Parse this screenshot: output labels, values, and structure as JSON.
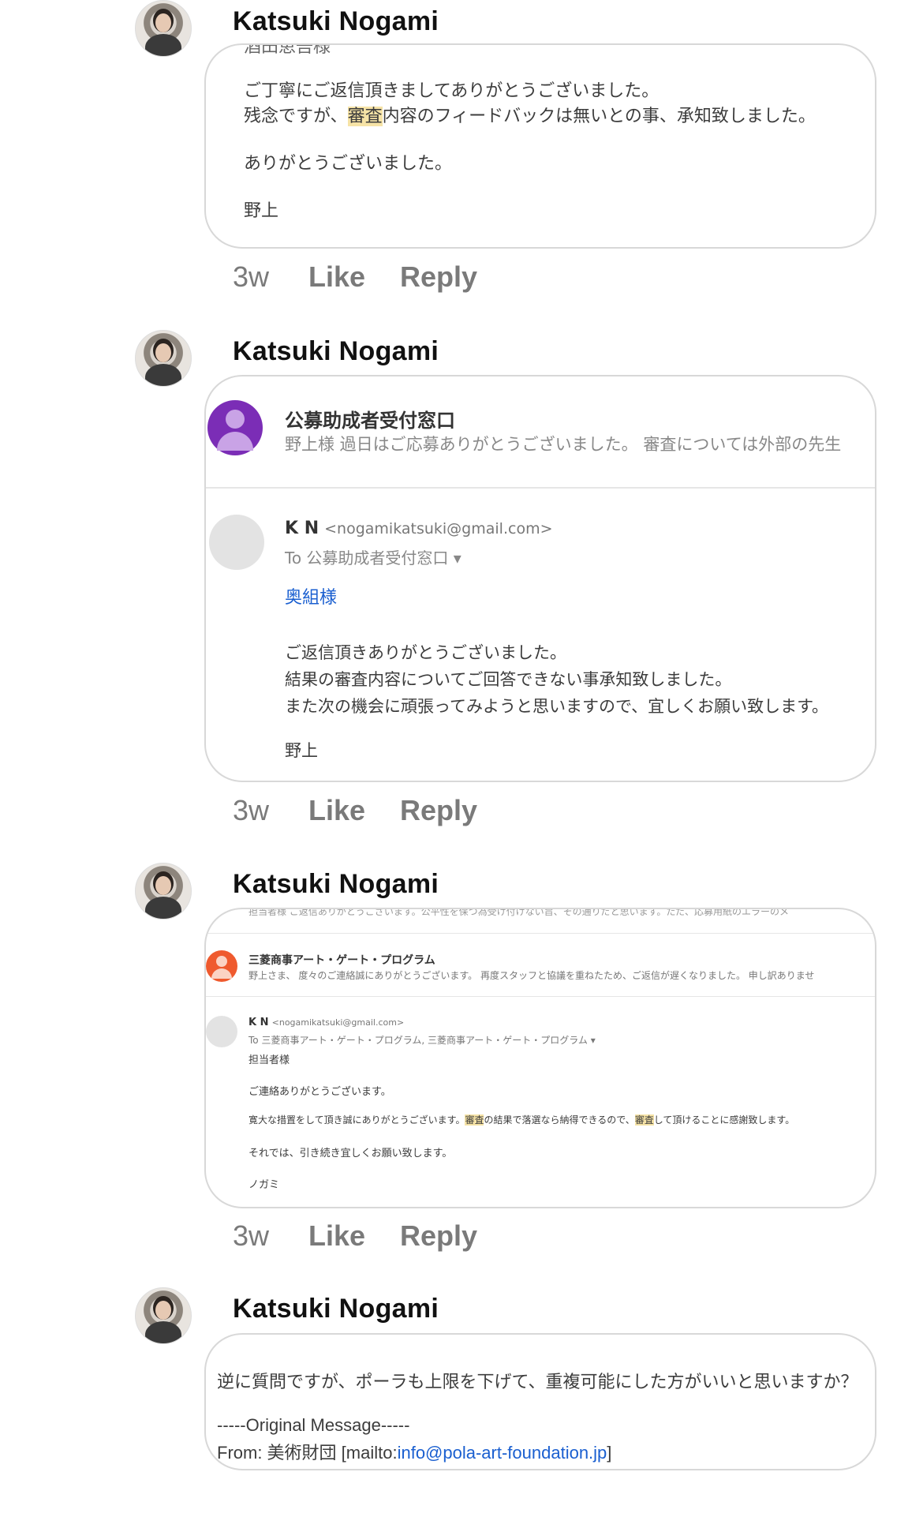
{
  "comments": [
    {
      "author": "Katsuki Nogami",
      "time": "3w",
      "like": "Like",
      "reply": "Reply",
      "email": {
        "top_cut": "酒田恵吾様",
        "lines": [
          "ご丁寧にご返信頂きましてありがとうございました。",
          "残念ですが、",
          "審査",
          "内容のフィードバックは無いとの事、承知致しました。",
          "ありがとうございました。",
          "野上"
        ]
      }
    },
    {
      "author": "Katsuki Nogami",
      "time": "3w",
      "like": "Like",
      "reply": "Reply",
      "email": {
        "sender1_name": "公募助成者受付窓口",
        "sender1_preview": "野上様 過日はご応募ありがとうございました。 審査については外部の先生",
        "sender2_name": "K N",
        "sender2_email": "<nogamikatsuki@gmail.com>",
        "to_line": "To 公募助成者受付窓口 ▾",
        "greeting": "奥組様",
        "lines": [
          "ご返信頂きありがとうございました。",
          "結果の審査内容についてご回答できない事承知致しました。",
          "また次の機会に頑張ってみようと思いますので、宜しくお願い致します。",
          "野上"
        ]
      }
    },
    {
      "author": "Katsuki Nogami",
      "time": "3w",
      "like": "Like",
      "reply": "Reply",
      "email": {
        "top_cut": "担当者様 ご返信ありがとうございます。公平性を保つ為受け付けない旨、その通りだと思います。ただ、応募用紙のエラーのメ",
        "sender1_name": "三菱商事アート・ゲート・プログラム",
        "sender1_preview": "野上さま、 度々のご連絡誠にありがとうございます。 再度スタッフと協議を重ねたため、ご返信が遅くなりました。 申し訳ありませ",
        "sender2_name": "K N",
        "sender2_email": "<nogamikatsuki@gmail.com>",
        "to_line": "To 三菱商事アート・ゲート・プログラム, 三菱商事アート・ゲート・プログラム ▾",
        "lines": [
          "担当者様",
          "ご連絡ありがとうございます。",
          "寛大な措置をして頂き誠にありがとうございます。",
          "審査",
          "の結果で落選なら納得できるので、",
          "審査",
          "して頂けることに感謝致します。",
          "それでは、引き続き宜しくお願い致します。",
          "ノガミ"
        ]
      }
    },
    {
      "author": "Katsuki Nogami",
      "email": {
        "question": "逆に質問ですが、ポーラも上限を下げて、重複可能にした方がいいと思いますか？",
        "original": "-----Original Message-----",
        "from_prefix": "From: 美術財団 [mailto:",
        "from_link": "info@pola-art-foundation.jp",
        "from_suffix": "]"
      }
    }
  ]
}
